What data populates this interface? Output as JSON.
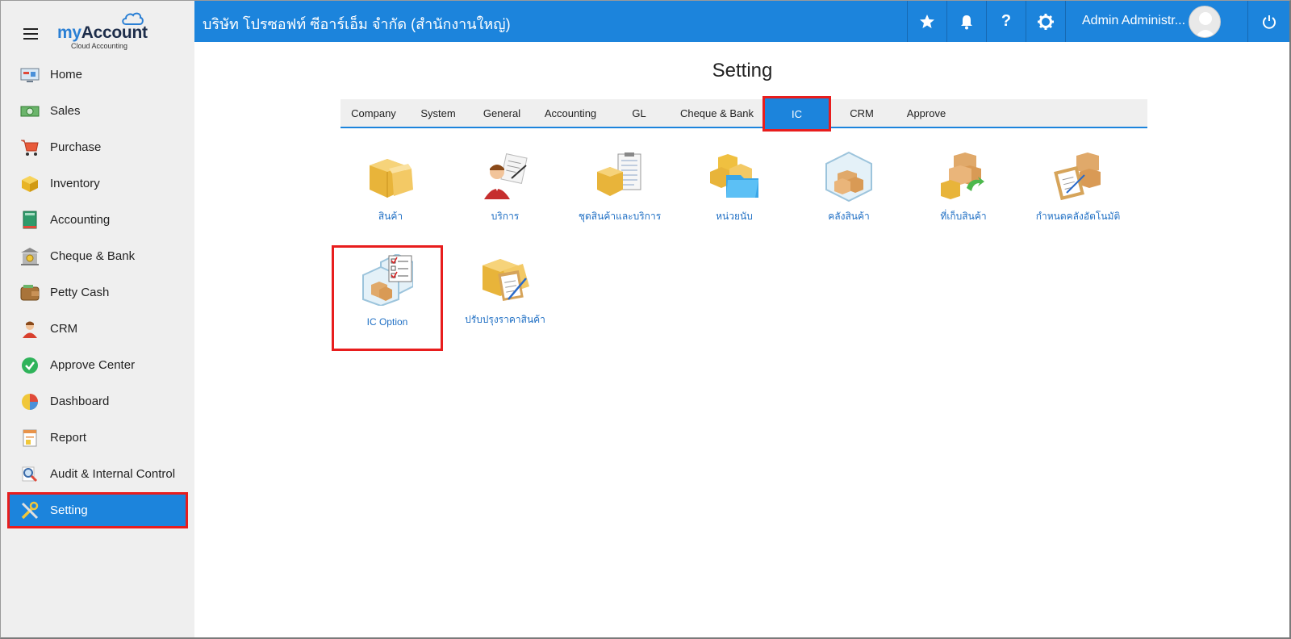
{
  "app": {
    "logo": {
      "brand_prefix": "my",
      "brand_suffix": "Account",
      "subtitle": "Cloud Accounting"
    },
    "company_name": "บริษัท โปรซอฟท์ ซีอาร์เอ็ม จำกัด (สำนักงานใหญ่)",
    "user_name": "Admin Administr...",
    "colors": {
      "primary": "#1c84dc",
      "highlight": "#e81d1d",
      "sidebar_bg": "#efefef",
      "link": "#1f6fc4"
    }
  },
  "topbar": {
    "icons": [
      "star-icon",
      "bell-icon",
      "help-icon",
      "gear-icon"
    ],
    "help_glyph": "?"
  },
  "sidebar": {
    "items": [
      {
        "label": "Home",
        "icon": "home-icon"
      },
      {
        "label": "Sales",
        "icon": "sales-icon"
      },
      {
        "label": "Purchase",
        "icon": "cart-icon"
      },
      {
        "label": "Inventory",
        "icon": "box-icon"
      },
      {
        "label": "Accounting",
        "icon": "ledger-icon"
      },
      {
        "label": "Cheque & Bank",
        "icon": "bank-icon"
      },
      {
        "label": "Petty Cash",
        "icon": "wallet-icon"
      },
      {
        "label": "CRM",
        "icon": "person-icon"
      },
      {
        "label": "Approve Center",
        "icon": "check-circle-icon"
      },
      {
        "label": "Dashboard",
        "icon": "pie-chart-icon"
      },
      {
        "label": "Report",
        "icon": "report-icon"
      },
      {
        "label": "Audit & Internal Control",
        "icon": "magnifier-icon"
      },
      {
        "label": "Setting",
        "icon": "tools-icon",
        "active": true
      }
    ]
  },
  "main": {
    "title": "Setting",
    "tabs": [
      {
        "label": "Company"
      },
      {
        "label": "System"
      },
      {
        "label": "General"
      },
      {
        "label": "Accounting"
      },
      {
        "label": "GL"
      },
      {
        "label": "Cheque & Bank"
      },
      {
        "label": "IC",
        "active": true
      },
      {
        "label": "CRM"
      },
      {
        "label": "Approve"
      }
    ],
    "tiles": [
      {
        "label": "สินค้า",
        "icon": "product-boxes-icon"
      },
      {
        "label": "บริการ",
        "icon": "service-person-icon"
      },
      {
        "label": "ชุดสินค้าและบริการ",
        "icon": "product-set-icon"
      },
      {
        "label": "หน่วยนับ",
        "icon": "unit-folder-icon"
      },
      {
        "label": "คลังสินค้า",
        "icon": "warehouse-icon"
      },
      {
        "label": "ที่เก็บสินค้า",
        "icon": "storage-location-icon"
      },
      {
        "label": "กำหนดคลังอัตโนมัติ",
        "icon": "auto-warehouse-icon"
      },
      {
        "label": "IC Option",
        "icon": "ic-option-icon",
        "selected": true
      },
      {
        "label": "ปรับปรุงราคาสินค้า",
        "icon": "price-adjust-icon"
      }
    ]
  }
}
